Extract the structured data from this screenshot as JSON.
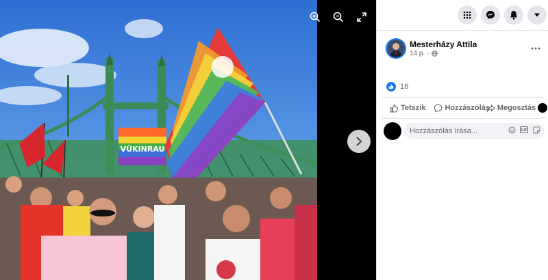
{
  "post": {
    "author": "Mesterházy Attila",
    "time": "14 p.",
    "like_count": "16"
  },
  "actions": {
    "like": "Tetszik",
    "comment": "Hozzászólás",
    "share": "Megosztás"
  },
  "comment_box": {
    "placeholder": "Hozzászólás írása..."
  },
  "photo": {
    "banner_text": "VÜKINRAU"
  },
  "icons": [
    "zoom-in-icon",
    "zoom-out-icon",
    "fullscreen-icon",
    "next-arrow-icon",
    "menu-grid-icon",
    "messenger-icon",
    "notifications-bell-icon",
    "account-caret-icon",
    "globe-icon",
    "more-options-icon",
    "like-reaction-icon",
    "like-thumb-icon",
    "comment-bubble-icon",
    "share-arrow-icon",
    "emoji-icon",
    "gif-icon",
    "sticker-icon"
  ],
  "colors": {
    "facebook_blue": "#1877f2",
    "secondary_text": "#65676b",
    "primary_text": "#050505"
  }
}
